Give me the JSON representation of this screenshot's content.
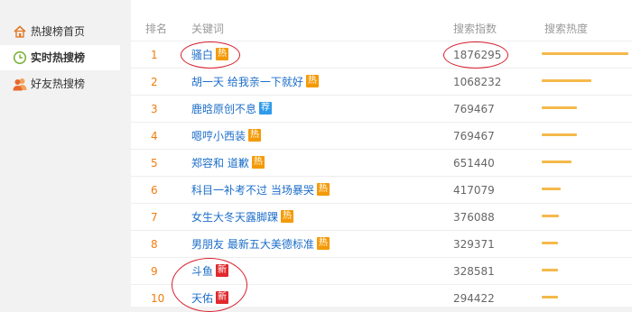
{
  "sidebar": {
    "items": [
      {
        "label": "热搜榜首页",
        "icon": "home-icon",
        "active": false
      },
      {
        "label": "实时热搜榜",
        "icon": "clock-icon",
        "active": true
      },
      {
        "label": "好友热搜榜",
        "icon": "friends-icon",
        "active": false
      }
    ]
  },
  "table": {
    "headers": {
      "rank": "排名",
      "keyword": "关键词",
      "index": "搜索指数",
      "heat": "搜索热度"
    },
    "max_index": 1876295,
    "rows": [
      {
        "rank": "1",
        "keyword": "骚白",
        "badge": "热",
        "badge_type": "hot",
        "index": "1876295",
        "value": 1876295
      },
      {
        "rank": "2",
        "keyword": "胡一天 给我亲一下就好",
        "badge": "热",
        "badge_type": "hot",
        "index": "1068232",
        "value": 1068232
      },
      {
        "rank": "3",
        "keyword": "鹿晗原创不息",
        "badge": "荐",
        "badge_type": "rec",
        "index": "769467",
        "value": 769467
      },
      {
        "rank": "4",
        "keyword": "嗯哼小西装",
        "badge": "热",
        "badge_type": "hot",
        "index": "769467",
        "value": 769467
      },
      {
        "rank": "5",
        "keyword": "郑容和 道歉",
        "badge": "热",
        "badge_type": "hot",
        "index": "651440",
        "value": 651440
      },
      {
        "rank": "6",
        "keyword": "科目一补考不过 当场暴哭",
        "badge": "热",
        "badge_type": "hot",
        "index": "417079",
        "value": 417079
      },
      {
        "rank": "7",
        "keyword": "女生大冬天露脚踝",
        "badge": "热",
        "badge_type": "hot",
        "index": "376088",
        "value": 376088
      },
      {
        "rank": "8",
        "keyword": "男朋友 最新五大美德标准",
        "badge": "热",
        "badge_type": "hot",
        "index": "329371",
        "value": 329371
      },
      {
        "rank": "9",
        "keyword": "斗鱼",
        "badge": "新",
        "badge_type": "new",
        "index": "328581",
        "value": 328581
      },
      {
        "rank": "10",
        "keyword": "天佑",
        "badge": "新",
        "badge_type": "new",
        "index": "294422",
        "value": 294422
      }
    ]
  },
  "colors": {
    "accent_rank": "#f27c0c",
    "keyword_link": "#1d6ec9",
    "heat_bar": "#f5b94a",
    "annotation_circle": "#d81e2e"
  }
}
